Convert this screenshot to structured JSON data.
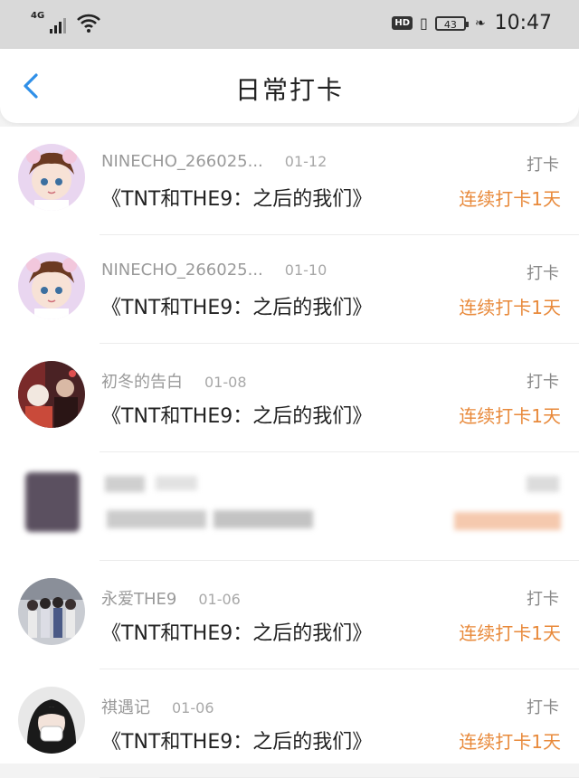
{
  "status_bar": {
    "network": "4G",
    "hd": "HD",
    "battery": "43",
    "time": "10:47"
  },
  "header": {
    "title": "日常打卡"
  },
  "records": [
    {
      "name": "NINECHO_266025...",
      "date": "01-12",
      "book": "《TNT和THE9：之后的我们》",
      "action": "打卡",
      "streak": "连续打卡1天"
    },
    {
      "name": "NINECHO_266025...",
      "date": "01-10",
      "book": "《TNT和THE9：之后的我们》",
      "action": "打卡",
      "streak": "连续打卡1天"
    },
    {
      "name": "初冬的告白",
      "date": "01-08",
      "book": "《TNT和THE9：之后的我们》",
      "action": "打卡",
      "streak": "连续打卡1天"
    },
    {
      "name": "",
      "date": "",
      "book": "",
      "action": "",
      "streak": ""
    },
    {
      "name": "永爱THE9",
      "date": "01-06",
      "book": "《TNT和THE9：之后的我们》",
      "action": "打卡",
      "streak": "连续打卡1天"
    },
    {
      "name": "祺遇记",
      "date": "01-06",
      "book": "《TNT和THE9：之后的我们》",
      "action": "打卡",
      "streak": "连续打卡1天"
    }
  ],
  "colors": {
    "accent": "#e8893a",
    "back_arrow": "#2f8fe8"
  }
}
